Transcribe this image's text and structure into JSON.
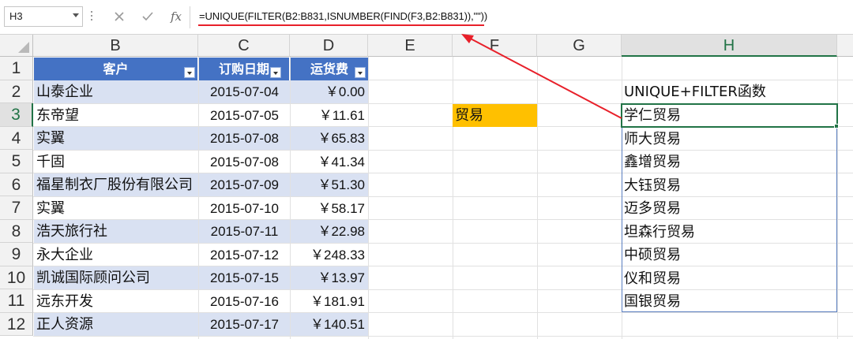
{
  "formula_bar": {
    "name_box": "H3",
    "formula": "=UNIQUE(FILTER(B2:B831,ISNUMBER(FIND(F3,B2:B831)),\"\"))",
    "fx_label": "fx"
  },
  "columns": [
    "B",
    "C",
    "D",
    "E",
    "F",
    "G",
    "H"
  ],
  "rows": [
    "1",
    "2",
    "3",
    "4",
    "5",
    "6",
    "7",
    "8",
    "9",
    "10",
    "11",
    "12"
  ],
  "table": {
    "headers": [
      "客户",
      "订购日期",
      "运货费"
    ],
    "rows": [
      {
        "customer": "山泰企业",
        "date": "2015-07-04",
        "freight": "￥0.00"
      },
      {
        "customer": "东帝望",
        "date": "2015-07-05",
        "freight": "￥11.61"
      },
      {
        "customer": "实翼",
        "date": "2015-07-08",
        "freight": "￥65.83"
      },
      {
        "customer": "千固",
        "date": "2015-07-08",
        "freight": "￥41.34"
      },
      {
        "customer": "福星制衣厂股份有限公司",
        "date": "2015-07-09",
        "freight": "￥51.30"
      },
      {
        "customer": "实翼",
        "date": "2015-07-10",
        "freight": "￥58.17"
      },
      {
        "customer": "浩天旅行社",
        "date": "2015-07-11",
        "freight": "￥22.98"
      },
      {
        "customer": "永大企业",
        "date": "2015-07-12",
        "freight": "￥248.33"
      },
      {
        "customer": "凯诚国际顾问公司",
        "date": "2015-07-15",
        "freight": "￥13.97"
      },
      {
        "customer": "远东开发",
        "date": "2015-07-16",
        "freight": "￥181.91"
      },
      {
        "customer": "正人资源",
        "date": "2015-07-17",
        "freight": "￥140.51"
      }
    ]
  },
  "criteria_cell": {
    "value": "贸易",
    "color": "#ffc000"
  },
  "result": {
    "title": "UNIQUE+FILTER函数",
    "items": [
      "学仁贸易",
      "师大贸易",
      "鑫增贸易",
      "大钰贸易",
      "迈多贸易",
      "坦森行贸易",
      "中硕贸易",
      "仪和贸易",
      "国银贸易"
    ]
  },
  "colors": {
    "table_header": "#4472c4",
    "band": "#d9e1f2",
    "accent": "#217346",
    "annotation": "#e8202a"
  }
}
